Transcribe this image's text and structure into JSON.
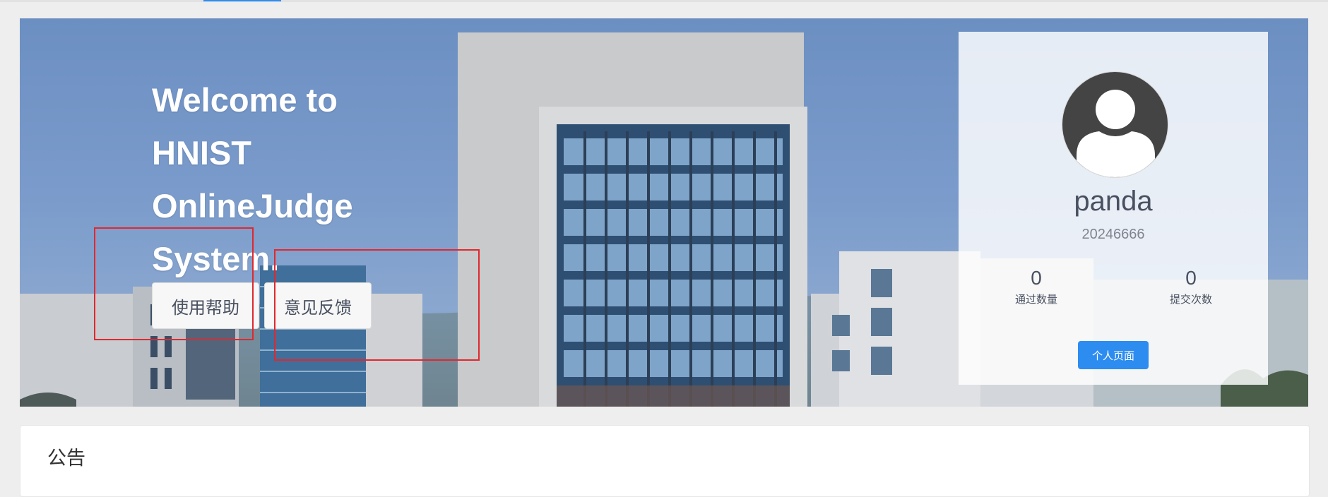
{
  "banner": {
    "welcome_lines": [
      "Welcome to",
      "HNIST",
      "OnlineJudge",
      "System."
    ],
    "help_button": "使用帮助",
    "feedback_button": "意见反馈"
  },
  "profile": {
    "username": "panda",
    "user_id": "20246666",
    "stats": {
      "passed_count": "0",
      "passed_label": "通过数量",
      "submit_count": "0",
      "submit_label": "提交次数"
    },
    "profile_button": "个人页面"
  },
  "announcement": {
    "title": "公告"
  },
  "colors": {
    "accent": "#2d8cf0",
    "annotation": "#e0282e",
    "background": "#eeeeee"
  }
}
